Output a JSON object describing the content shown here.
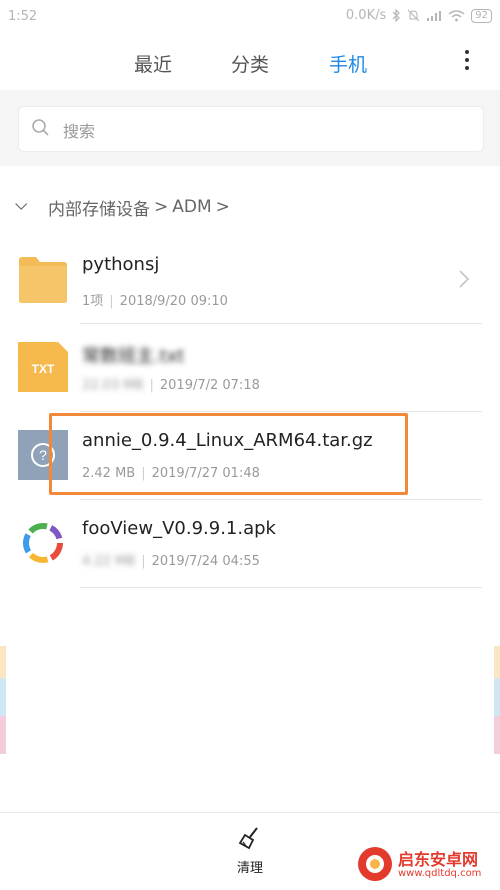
{
  "status_bar": {
    "time": "1:52",
    "network_speed": "0.0K/s",
    "battery": "92"
  },
  "tabs": [
    {
      "label": "最近",
      "active": false
    },
    {
      "label": "分类",
      "active": false
    },
    {
      "label": "手机",
      "active": true
    }
  ],
  "accent_color": "#1e88e5",
  "search": {
    "placeholder": "搜索"
  },
  "breadcrumb": {
    "root": "内部存储设备",
    "separator": ">",
    "current": "ADM"
  },
  "files": [
    {
      "name": "pythonsj",
      "size": "1项",
      "date": "2018/9/20 09:10",
      "icon": "folder-icon",
      "has_chevron": true
    },
    {
      "name": "常数班主.txt",
      "size": "22.03 MB",
      "date": "2019/7/2 07:18",
      "icon": "txt-file-icon",
      "blurred": true,
      "icon_label": "TXT"
    },
    {
      "name": "annie_0.9.4_Linux_ARM64.tar.gz",
      "size": "2.42 MB",
      "date": "2019/7/27 01:48",
      "icon": "unknown-file-icon",
      "highlighted": true
    },
    {
      "name": "fooView_V0.9.9.1.apk",
      "size": "4.22 MB",
      "date": "2019/7/24 04:55",
      "icon": "apk-app-icon",
      "partially_blurred": true
    }
  ],
  "highlight_color": "#f2883a",
  "bottom_bar": {
    "clean_label": "清理"
  },
  "watermark": {
    "title": "启东安卓网",
    "url": "www.qdltdq.com"
  }
}
